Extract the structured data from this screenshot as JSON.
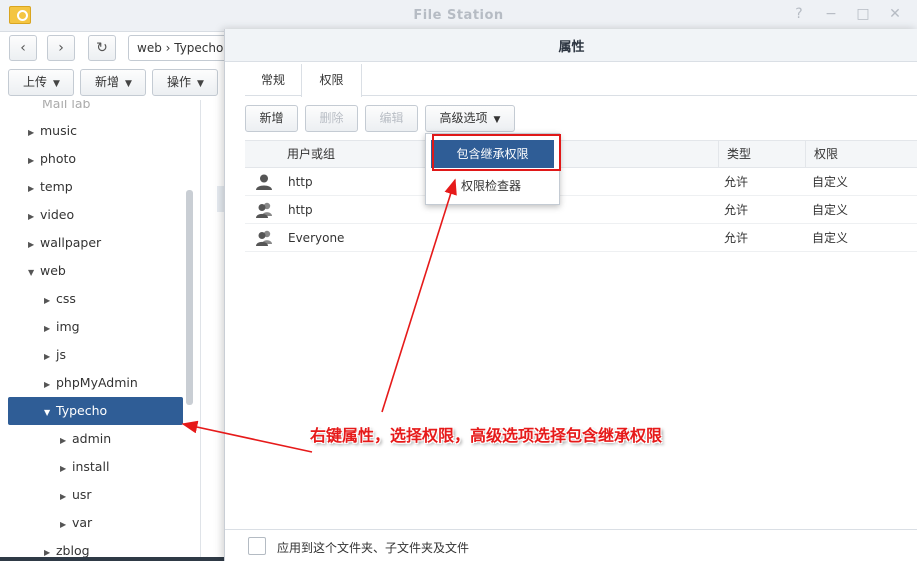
{
  "window": {
    "title": "File Station",
    "controls": [
      "?",
      "−",
      "□",
      "✕"
    ]
  },
  "nav": {
    "back_icon": "chevron-left-icon",
    "forward_icon": "chevron-right-icon",
    "refresh_icon": "refresh-icon",
    "path_text": "web › Typecho"
  },
  "toolbar": {
    "upload": "上传",
    "create": "新增",
    "action": "操作"
  },
  "tree": {
    "cut_top": "Mail lab",
    "items": [
      {
        "label": "music",
        "expanded": false
      },
      {
        "label": "photo",
        "expanded": false
      },
      {
        "label": "temp",
        "expanded": false
      },
      {
        "label": "video",
        "expanded": false
      },
      {
        "label": "wallpaper",
        "expanded": false
      },
      {
        "label": "web",
        "expanded": true
      },
      {
        "label": "css",
        "expanded": false
      },
      {
        "label": "img",
        "expanded": false
      },
      {
        "label": "js",
        "expanded": false
      },
      {
        "label": "phpMyAdmin",
        "expanded": false
      },
      {
        "label": "Typecho",
        "expanded": true,
        "selected": true
      },
      {
        "label": "admin",
        "expanded": false
      },
      {
        "label": "install",
        "expanded": false
      },
      {
        "label": "usr",
        "expanded": false
      },
      {
        "label": "var",
        "expanded": false
      },
      {
        "label": "zblog",
        "expanded": false
      }
    ]
  },
  "dialog": {
    "title": "属性",
    "tabs": [
      {
        "label": "常规",
        "active": false
      },
      {
        "label": "权限",
        "active": true
      }
    ],
    "buttons": {
      "create": "新增",
      "delete": "删除",
      "edit": "编辑",
      "advanced": "高级选项"
    },
    "table": {
      "headers": [
        "用户或组",
        "类型",
        "权限"
      ],
      "rows": [
        {
          "icon": "user-icon",
          "name": "http",
          "type": "允许",
          "perm": "自定义"
        },
        {
          "icon": "group-icon",
          "name": "http",
          "type": "允许",
          "perm": "自定义"
        },
        {
          "icon": "group-icon",
          "name": "Everyone",
          "type": "允许",
          "perm": "自定义"
        }
      ]
    },
    "footer_checkbox": "应用到这个文件夹、子文件夹及文件"
  },
  "dropdown": {
    "items": [
      "包含继承权限",
      "权限检查器"
    ]
  },
  "annotation": "右键属性，选择权限，高级选项选择包含继承权限",
  "colors": {
    "accent": "#2f5d96",
    "annotation": "#e61a1a"
  }
}
